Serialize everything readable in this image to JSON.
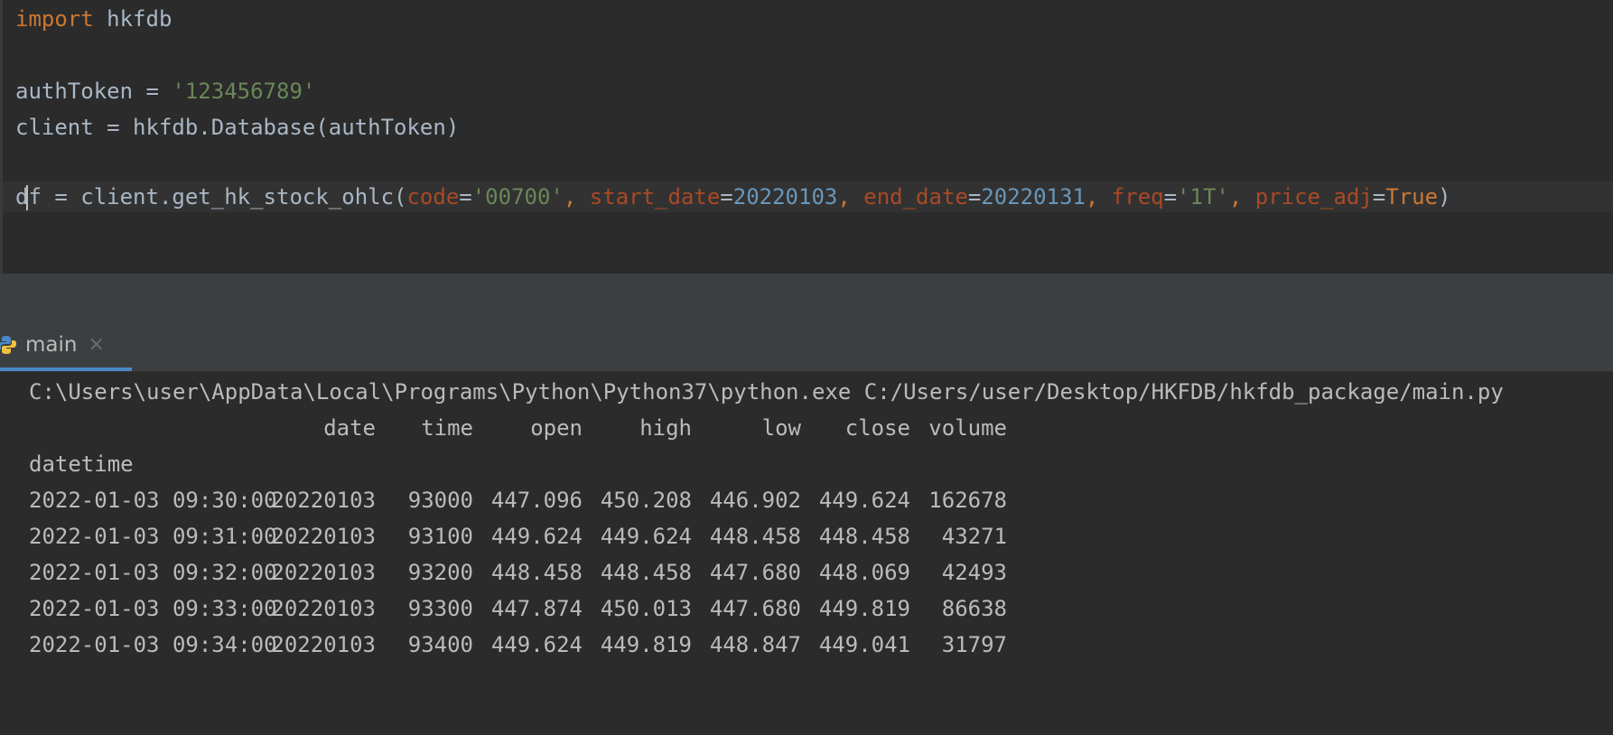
{
  "editor": {
    "line1": {
      "keyword": "import",
      "module": "hkfdb"
    },
    "line2": {
      "var": "authToken",
      "eq": " = ",
      "value": "'123456789'"
    },
    "line3": {
      "text": "client = hkfdb.Database(authToken)"
    },
    "line4": {
      "var_head": "d",
      "var_tail": "f",
      "call": " = client.get_hk_stock_ohlc(",
      "p1": "code",
      "v1": "'00700'",
      "p2": "start_date",
      "v2": "20220103",
      "p3": "end_date",
      "v3": "20220131",
      "p4": "freq",
      "v4": "'1T'",
      "p5": "price_adj",
      "v5": "True",
      "sep": ", ",
      "eq": "=",
      "close": ")"
    }
  },
  "run_tab": {
    "label": "main",
    "close": "×",
    "icon": "python-icon"
  },
  "console": {
    "command": "C:\\Users\\user\\AppData\\Local\\Programs\\Python\\Python37\\python.exe C:/Users/user/Desktop/HKFDB/hkfdb_package/main.py",
    "columns": [
      "date",
      "time",
      "open",
      "high",
      "low",
      "close",
      "volume"
    ],
    "index_name": "datetime",
    "rows": [
      [
        "2022-01-03 09:30:00",
        "20220103",
        "93000",
        "447.096",
        "450.208",
        "446.902",
        "449.624",
        "162678"
      ],
      [
        "2022-01-03 09:31:00",
        "20220103",
        "93100",
        "449.624",
        "449.624",
        "448.458",
        "448.458",
        "43271"
      ],
      [
        "2022-01-03 09:32:00",
        "20220103",
        "93200",
        "448.458",
        "448.458",
        "447.680",
        "448.069",
        "42493"
      ],
      [
        "2022-01-03 09:33:00",
        "20220103",
        "93300",
        "447.874",
        "450.013",
        "447.680",
        "449.819",
        "86638"
      ],
      [
        "2022-01-03 09:34:00",
        "20220103",
        "93400",
        "449.624",
        "449.819",
        "448.847",
        "449.041",
        "31797"
      ]
    ]
  },
  "colors": {
    "background": "#2b2b2b",
    "keyword": "#cc7832",
    "string": "#6a8759",
    "number": "#6897bb",
    "param": "#aa4926",
    "text": "#a9b7c6",
    "tab_accent": "#4a88c7"
  }
}
